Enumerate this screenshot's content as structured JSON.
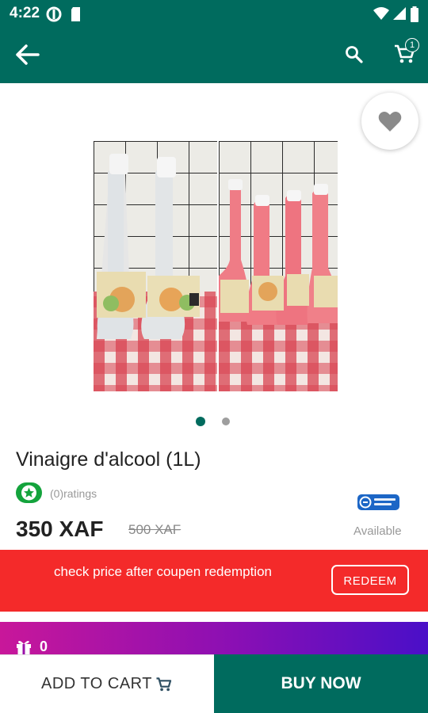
{
  "status_bar": {
    "time": "4:22"
  },
  "header": {
    "cart_count": "1"
  },
  "product": {
    "title": "Vinaigre d'alcool (1L)",
    "ratings_text": "(0)ratings",
    "price": "350 XAF",
    "old_price": "500 XAF",
    "availability": "Available",
    "carousel": {
      "total": 2,
      "active": 1
    }
  },
  "promo": {
    "message": "check price after coupen redemption",
    "redeem_label": "REDEEM"
  },
  "gift_bar": {
    "count": "0"
  },
  "actions": {
    "add_to_cart_label": "ADD TO CART",
    "buy_now_label": "BUY NOW"
  },
  "colors": {
    "primary": "#006b5e",
    "promo_red": "#f42a2a",
    "rating_green": "#14a33c"
  }
}
